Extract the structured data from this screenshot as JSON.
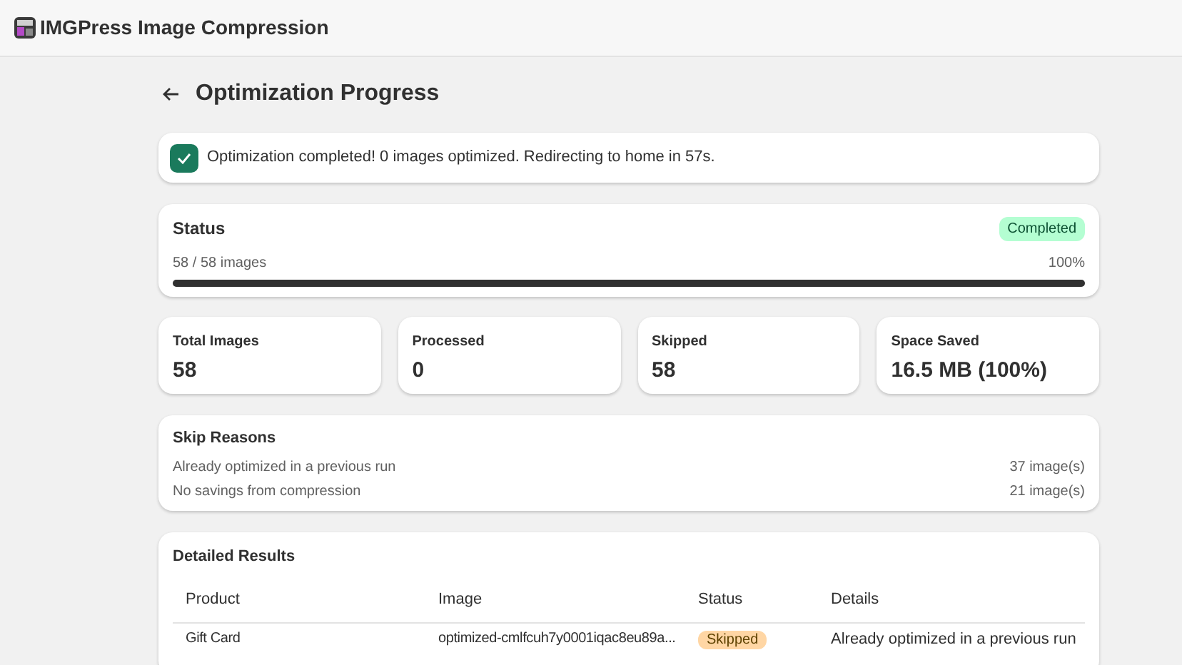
{
  "app": {
    "title": "IMGPress Image Compression"
  },
  "page": {
    "title": "Optimization Progress"
  },
  "banner": {
    "message": "Optimization completed! 0 images optimized. Redirecting to home in 57s."
  },
  "status": {
    "title": "Status",
    "badge": "Completed",
    "count": "58 / 58 images",
    "percent": "100%",
    "level": 1
  },
  "stats": [
    {
      "label": "Total Images",
      "value": "58"
    },
    {
      "label": "Processed",
      "value": "0"
    },
    {
      "label": "Skipped",
      "value": "58"
    },
    {
      "label": "Space Saved",
      "value": "16.5 MB (100%)"
    }
  ],
  "skip_reasons": {
    "title": "Skip Reasons",
    "items": [
      {
        "reason": "Already optimized in a previous run",
        "count": "37 image(s)"
      },
      {
        "reason": "No savings from compression",
        "count": "21 image(s)"
      }
    ]
  },
  "results": {
    "title": "Detailed Results",
    "columns": [
      "Product",
      "Image",
      "Status",
      "Details"
    ],
    "rows": [
      {
        "product": "Gift Card",
        "image": "optimized-cmlfcuh7y0001iqac8eu89a...",
        "status": "Skipped",
        "details": "Already optimized in a previous run"
      }
    ]
  }
}
